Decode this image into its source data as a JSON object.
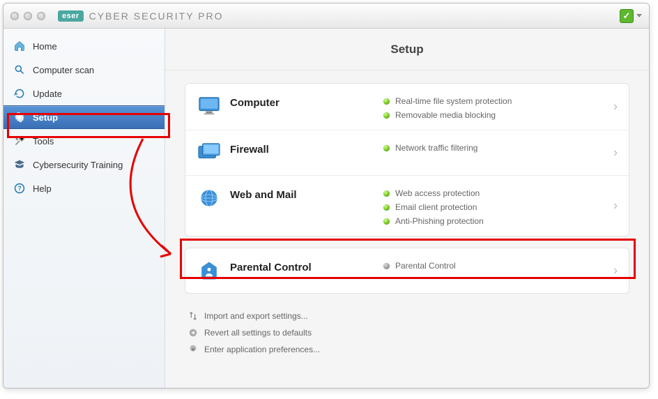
{
  "titlebar": {
    "brand": "eser",
    "app_name": "CYBER SECURITY PRO"
  },
  "sidebar": {
    "items": [
      {
        "label": "Home",
        "icon": "home-icon"
      },
      {
        "label": "Computer scan",
        "icon": "scan-icon"
      },
      {
        "label": "Update",
        "icon": "update-icon"
      },
      {
        "label": "Setup",
        "icon": "gear-icon",
        "active": true
      },
      {
        "label": "Tools",
        "icon": "tools-icon"
      },
      {
        "label": "Cybersecurity Training",
        "icon": "training-icon"
      },
      {
        "label": "Help",
        "icon": "help-icon"
      }
    ]
  },
  "page": {
    "title": "Setup"
  },
  "sections": [
    {
      "title": "Computer",
      "icon": "monitor-icon",
      "features": [
        {
          "label": "Real-time file system protection",
          "status": "on"
        },
        {
          "label": "Removable media blocking",
          "status": "on"
        }
      ]
    },
    {
      "title": "Firewall",
      "icon": "firewall-icon",
      "features": [
        {
          "label": "Network traffic filtering",
          "status": "on"
        }
      ]
    },
    {
      "title": "Web and Mail",
      "icon": "globe-icon",
      "features": [
        {
          "label": "Web access protection",
          "status": "on"
        },
        {
          "label": "Email client protection",
          "status": "on"
        },
        {
          "label": "Anti-Phishing protection",
          "status": "on"
        }
      ]
    }
  ],
  "parental": {
    "title": "Parental Control",
    "feature_label": "Parental Control",
    "status": "off"
  },
  "links": {
    "import_export": "Import and export settings...",
    "revert": "Revert all settings to defaults",
    "prefs": "Enter application preferences..."
  }
}
